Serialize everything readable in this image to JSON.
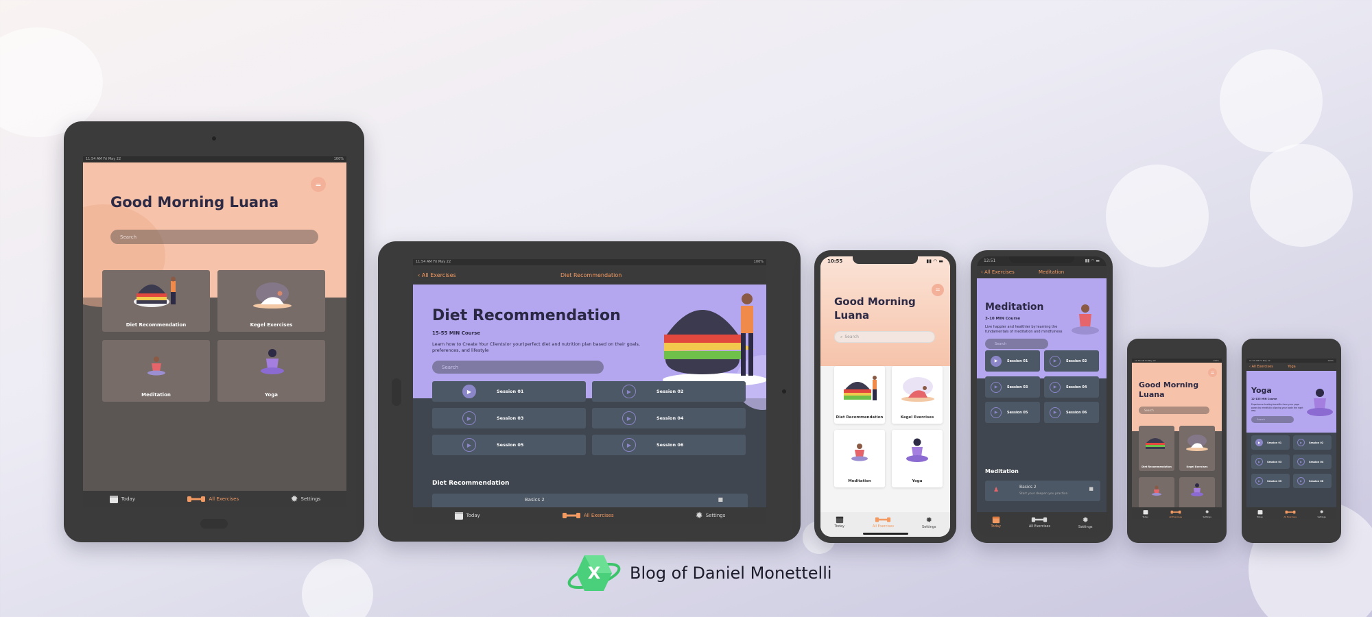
{
  "colors": {
    "peach": "#f6c3aa",
    "dark_bg": "#5b5653",
    "slate": "#3f4650",
    "purple": "#b4a7ef",
    "accent_orange": "#f39a62",
    "card_brown": "#776c68",
    "session_slate": "#4d5866"
  },
  "home": {
    "greeting": "Good Morning Luana",
    "greeting_line1": "Good Morning",
    "greeting_line2": "Luana",
    "search_placeholder": "Search",
    "menu_icon": "menu-lines-icon",
    "cards": [
      {
        "label": "Diet Recommendation",
        "illustration": "burger-illustration"
      },
      {
        "label": "Kegel Exercises",
        "illustration": "stretching-illustration"
      },
      {
        "label": "Meditation",
        "illustration": "meditating-person-illustration"
      },
      {
        "label": "Yoga",
        "illustration": "yoga-illustration"
      }
    ]
  },
  "status": {
    "ipad_time": "11:54 AM   Fri May 22",
    "ipad_battery": "100%",
    "iphone_time": "10:55",
    "iphone8_time": "12:51"
  },
  "tabs": [
    {
      "label": "Today",
      "icon": "calendar-icon"
    },
    {
      "label": "All Exercises",
      "icon": "dumbbell-icon"
    },
    {
      "label": "Settings",
      "icon": "gear-icon"
    }
  ],
  "diet": {
    "back_label": "All Exercises",
    "nav_title": "Diet Recommendation",
    "title": "Diet Recommendation",
    "subtitle": "15-55 MIN Course",
    "description": "Learn how to Create Your Clients(or your)perfect diet and nutrition plan based on their goals, preferences, and lifestyle",
    "search_placeholder": "Search",
    "sessions": [
      "Session 01",
      "Session 02",
      "Session 03",
      "Session 04",
      "Session 05",
      "Session 06"
    ],
    "section_title": "Diet Recommendation",
    "list_item": "Basics 2"
  },
  "meditation": {
    "back_label": "All Exercises",
    "nav_title": "Meditation",
    "title": "Meditation",
    "subtitle": "3-10 MIN Course",
    "description": "Live happier and healthier by learning the fundamentals of meditation and mindfulness",
    "search_placeholder": "Search",
    "sessions": [
      "Session 01",
      "Session 02",
      "Session 03",
      "Session 04",
      "Session 05",
      "Session 06"
    ],
    "section_title": "Meditation",
    "list_item": "Basics 2",
    "list_item_sub": "Start your deepen you practice"
  },
  "yoga": {
    "back_label": "All Exercises",
    "nav_title": "Yoga",
    "title": "Yoga",
    "subtitle": "12-135 MIN Course",
    "description": "Experience healing benefits from your yoga poses by mindfully aligning your body the right way",
    "search_placeholder": "Search",
    "sessions": [
      "Session 01",
      "Session 02",
      "Session 03",
      "Session 04",
      "Session 05",
      "Session 06"
    ]
  },
  "brand": {
    "logo": "x-logo-icon",
    "text": "Blog of Daniel Monettelli"
  }
}
